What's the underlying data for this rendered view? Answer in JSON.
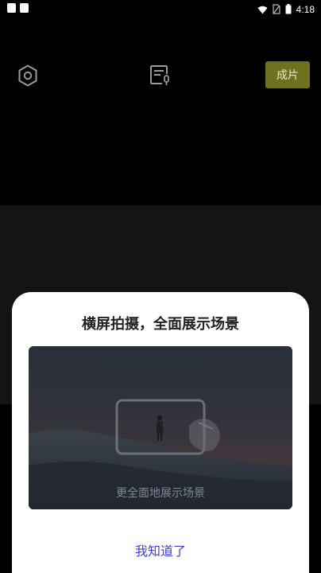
{
  "status_bar": {
    "time": "4:18",
    "icons": [
      "wifi-icon",
      "no-sim-icon",
      "battery-icon"
    ]
  },
  "toolbar": {
    "settings_icon": "hexagon-settings-icon",
    "script_icon": "script-document-icon",
    "finish_label": "成片",
    "finish_color": "#6d7220"
  },
  "dialog": {
    "title": "横屏拍摄，全面展示场景",
    "illustration_caption": "更全面地展示场景",
    "confirm_label": "我知道了",
    "confirm_color": "#3d3fd4"
  }
}
